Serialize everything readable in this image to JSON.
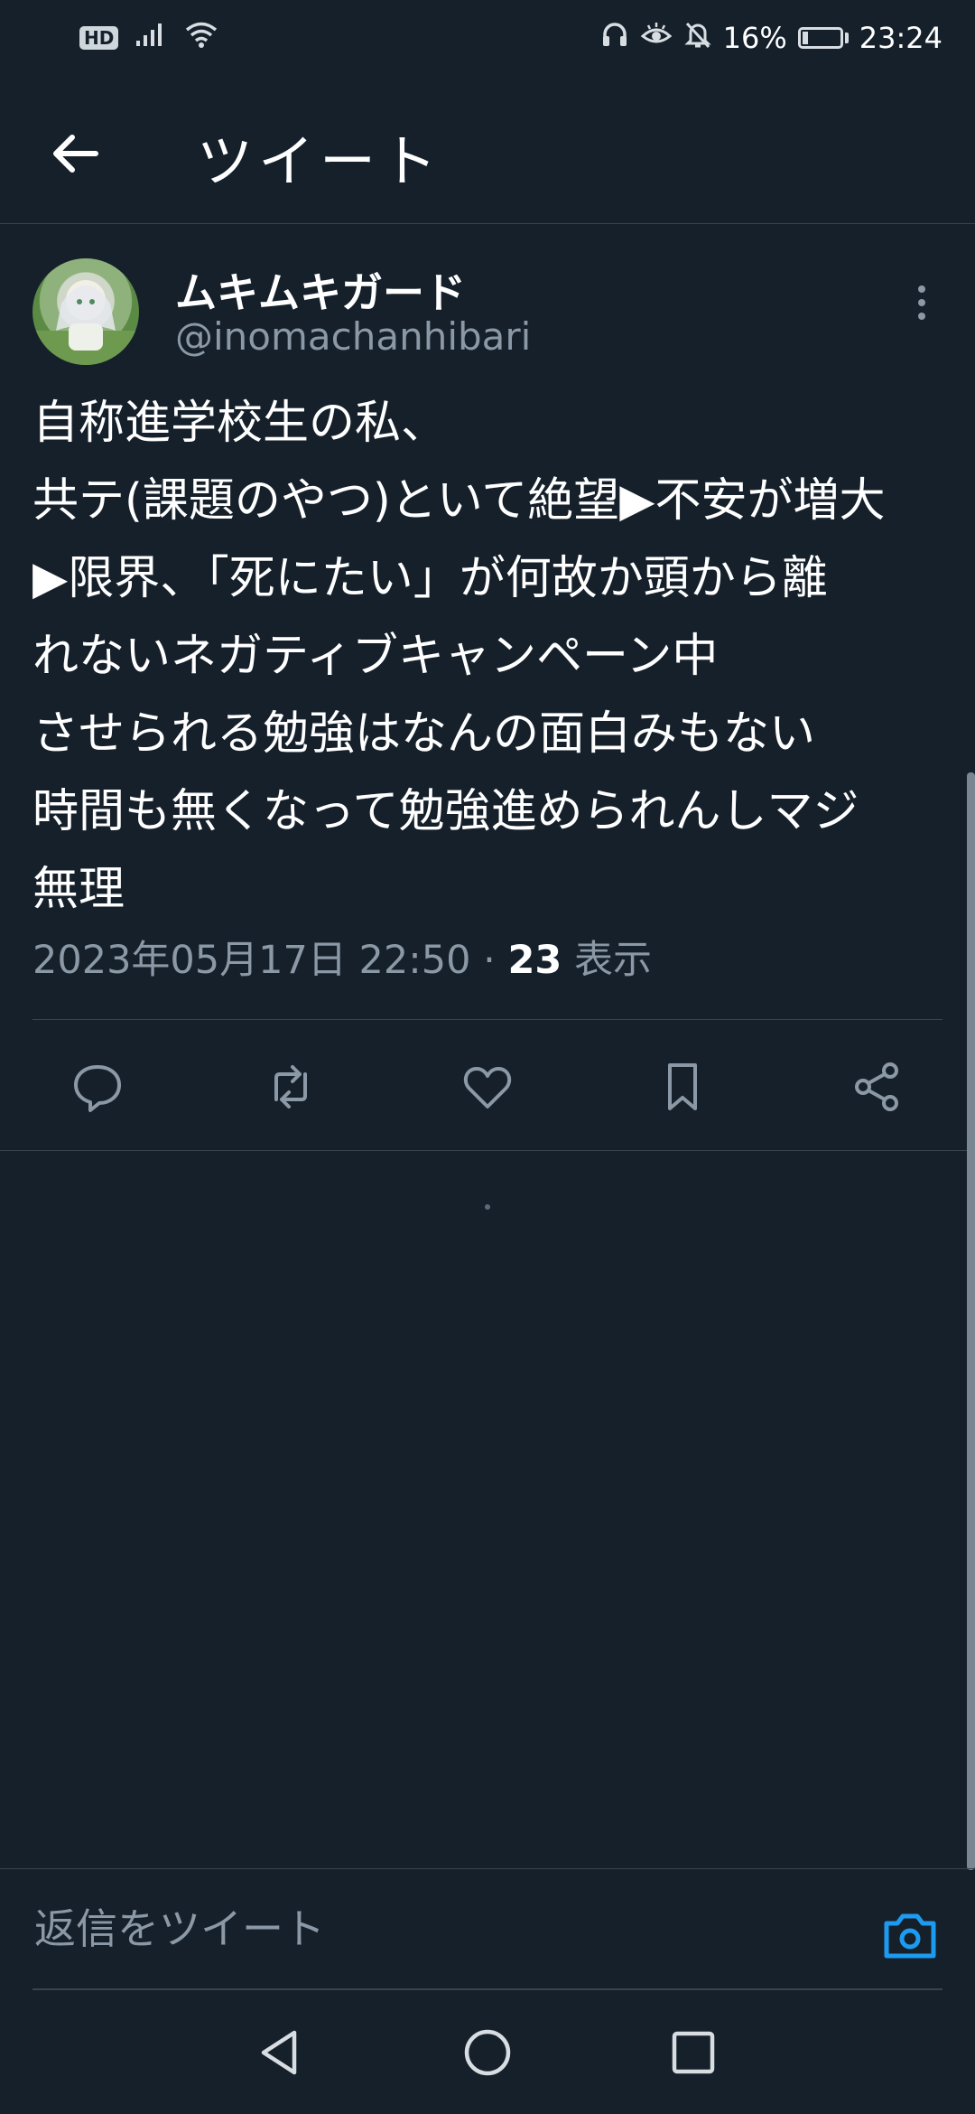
{
  "status_bar": {
    "hd_badge": "HD",
    "battery_percent": "16%",
    "battery_level": 0.16,
    "time": "23:24",
    "icons": [
      "signal-icon",
      "wifi-icon",
      "headphones-icon",
      "eye-comfort-icon",
      "notifications-off-icon",
      "battery-charging-icon"
    ]
  },
  "header": {
    "title": "ツイート",
    "back_icon": "arrow-left-icon"
  },
  "tweet": {
    "display_name": "ムキムキガード",
    "handle": "@inomachanhibari",
    "lines": [
      "自称進学校生の私、",
      "共テ(課題のやつ)といて絶望▶不安が増大",
      "▶限界、「死にたい」が何故か頭から離",
      "れないネガティブキャンペーン中",
      "させられる勉強はなんの面白みもない",
      "時間も無くなって勉強進められんしマジ",
      "無理"
    ],
    "timestamp": "2023年05月17日 22:50 · ",
    "views_count": "23",
    "views_label": " 表示",
    "actions": [
      "reply-icon",
      "retweet-icon",
      "like-icon",
      "bookmark-icon",
      "share-icon"
    ]
  },
  "reply_bar": {
    "placeholder": "返信をツイート",
    "camera_icon": "camera-icon"
  },
  "colors": {
    "background": "#15202b",
    "divider": "#38444d",
    "secondary_text": "#8b98a5",
    "accent": "#1d9bf0"
  }
}
